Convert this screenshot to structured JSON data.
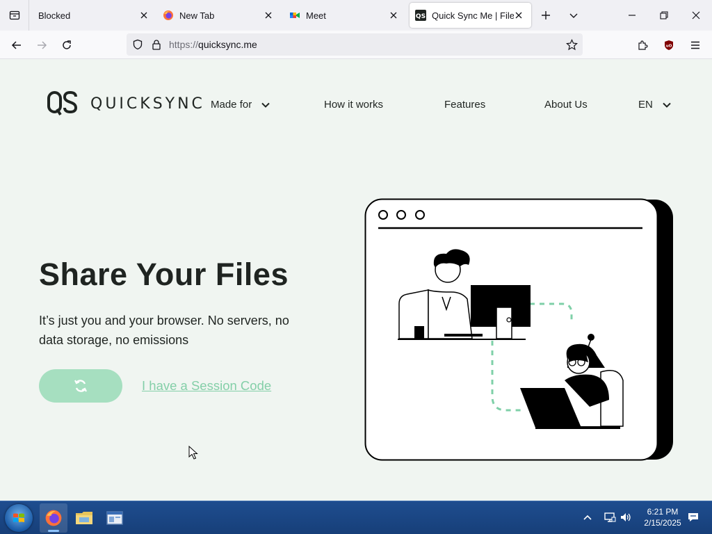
{
  "browser": {
    "tabs": [
      {
        "label": "Blocked",
        "active": false
      },
      {
        "label": "New Tab",
        "active": false
      },
      {
        "label": "Meet",
        "active": false
      },
      {
        "label": "Quick Sync Me | File &",
        "active": true
      }
    ],
    "url_protocol": "https://",
    "url_host": "quicksync.me"
  },
  "site": {
    "logo_mark": "QS",
    "brand": "QUICKSYNC",
    "nav": {
      "made_for": "Made for",
      "how_it_works": "How it works",
      "features": "Features",
      "about_us": "About Us",
      "language": "EN"
    },
    "hero": {
      "title": "Share Your Files",
      "description": "It’s just you and your browser. No servers, no data storage, no emissions",
      "session_link": "I have a Session Code"
    },
    "colors": {
      "background": "#f0f5f1",
      "accent": "#a6dfc0",
      "link": "#84cfa8",
      "text": "#1f2421"
    }
  },
  "taskbar": {
    "time": "6:21 PM",
    "date": "2/15/2025",
    "apps": [
      "firefox-icon",
      "file-explorer-icon",
      "window-app-icon"
    ]
  }
}
